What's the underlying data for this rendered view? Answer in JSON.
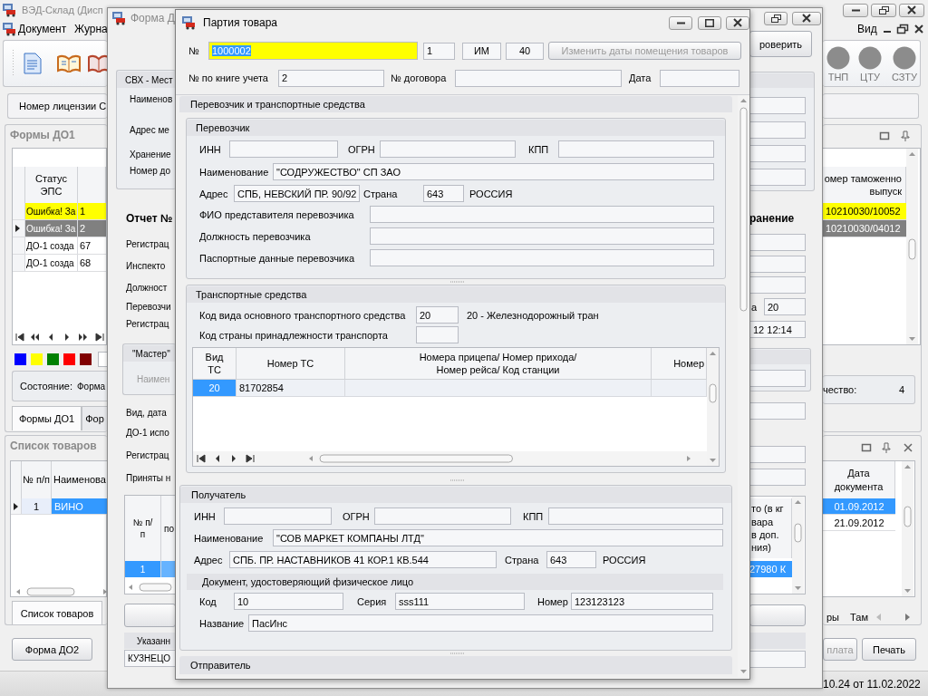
{
  "main_window": {
    "title": "ВЭД-Склад (Дисп",
    "menu": [
      "Документ",
      "Журна"
    ],
    "menu_right": "Вид",
    "indicators": [
      {
        "label": "ТНП"
      },
      {
        "label": "ЦТУ"
      },
      {
        "label": "СЗТУ"
      }
    ],
    "license_label": "Номер лицензии С",
    "do1_panel": {
      "title": "Формы ДО1",
      "column": "Статус ЭПС",
      "right_header": [
        "омер таможенно",
        "выпуск"
      ],
      "rows": [
        {
          "cells": [
            "Ошибка! За",
            "1"
          ],
          "right": "10210030/10052",
          "color": "#ffff00",
          "selected": false
        },
        {
          "cells": [
            "Ошибка! За",
            "2"
          ],
          "right": "10210030/04012",
          "selected": true
        },
        {
          "cells": [
            "ДО-1 созда",
            "67"
          ],
          "selected": false
        },
        {
          "cells": [
            "ДО-1 созда",
            "68"
          ],
          "selected": false
        }
      ]
    },
    "palette": [
      {
        "color": "#0000ff"
      },
      {
        "color": "#ffff00"
      },
      {
        "color": "#008000"
      },
      {
        "color": "#ff0000"
      },
      {
        "color": "#800000"
      }
    ],
    "state_label": "Состояние:",
    "state_value": "Форма",
    "count_label": "чество:",
    "count_value": "4",
    "do1_tabs": [
      {
        "label": "Формы ДО1",
        "selected": true
      },
      {
        "label": "Фор",
        "selected": false
      }
    ],
    "goods_panel": {
      "title": "Список товаров",
      "columns": [
        "№ п/п",
        "Наименова"
      ],
      "rows": [
        {
          "cells": [
            "1",
            "ВИНО"
          ],
          "selected": true
        }
      ],
      "doc_header": "Дата документа",
      "doc_rows": [
        {
          "date": "01.09.2012",
          "selected": true
        },
        {
          "date": "21.09.2012",
          "selected": false
        }
      ]
    },
    "goods_tabs": [
      {
        "label": "Список товаров",
        "selected": true
      },
      {
        "label": "ры",
        "selected": false
      },
      {
        "label": "Там",
        "selected": false
      }
    ],
    "buttons": [
      {
        "label": "Форма ДО2",
        "disabled": false
      },
      {
        "label": "плата",
        "disabled": true
      },
      {
        "label": "Печать",
        "disabled": false
      }
    ],
    "status_text": "10.24 от 11.02.2022"
  },
  "form_window": {
    "title": "Форма Д",
    "check_button": "роверить",
    "svh_group": "СВХ - Мест",
    "svh_labels": [
      "Наименов",
      "Адрес ме",
      "Хранение",
      "Номер до"
    ],
    "report_label": "Отчет №",
    "report_right": "ранение",
    "labels_1": [
      "Регистрац",
      "Инспекто",
      "Должност",
      "Перевозчи",
      "Регистрац"
    ],
    "transport_label": "а",
    "transport_value": "20",
    "reg_datetime": "12 12:14",
    "master_group": "\"Мастер\"",
    "master_label": "Наимен",
    "labels_2": [
      "Вид, дата",
      "ДО-1 испо",
      "Регистрац",
      "Приняты н"
    ],
    "grid": {
      "columns": [
        "№ п/п",
        "по"
      ],
      "right_header": [
        "то (в кг",
        "вара",
        "в доп.",
        "ния)"
      ],
      "rows": [
        {
          "cells": [
            "1"
          ],
          "right": "27980 К",
          "selected": true
        }
      ]
    },
    "specified_label": "Указанн",
    "specified_value": "КУЗНЕЦО"
  },
  "dialog": {
    "title": "Партия товара",
    "number_label": "№",
    "number": "1000002",
    "number_text_selected": true,
    "sub_number": "1",
    "kind": "ИМ",
    "count": "40",
    "change_dates_button": {
      "label": "Изменить даты помещения товаров",
      "disabled": true
    },
    "book_label": "№ по книге учета",
    "book_value": "2",
    "contract_label": "№ договора",
    "date_label": "Дата",
    "carrier_section": "Перевозчик и транспортные средства",
    "carrier": {
      "title": "Перевозчик",
      "inn_label": "ИНН",
      "ogrn_label": "ОГРН",
      "kpp_label": "КПП",
      "name_label": "Наименование",
      "name": "\"СОДРУЖЕСТВО\" СП ЗАО",
      "address_label": "Адрес",
      "address": "СПБ, НЕВСКИЙ ПР. 90/92",
      "country_label": "Страна",
      "country_code": "643",
      "country": "РОССИЯ",
      "rep_label": "ФИО представителя перевозчика",
      "position_label": "Должность перевозчика",
      "passport_label": "Паспортные данные перевозчика"
    },
    "transport": {
      "title": "Транспортные средства",
      "type_label": "Код вида основного транспортного средства",
      "type_code": "20",
      "type_name": "20 - Железнодорожный тран",
      "country_label": "Код страны принадлежности транспорта",
      "columns": [
        "Вид\nТС",
        "Номер ТС",
        "Номера прицепа/ Номер прихода/\nНомер рейса/ Код станции",
        "Номер"
      ],
      "rows": [
        {
          "cells": [
            "20",
            "81702854"
          ],
          "selected": true
        }
      ]
    },
    "recipient": {
      "title": "Получатель",
      "inn_label": "ИНН",
      "ogrn_label": "ОГРН",
      "kpp_label": "КПП",
      "name_label": "Наименование",
      "name": "\"СОВ МАРКЕТ КОМПАНЫ ЛТД\"",
      "address_label": "Адрес",
      "address": "СПБ. ПР. НАСТАВНИКОВ 41 КОР.1 КВ.544",
      "country_label": "Страна",
      "country_code": "643",
      "country": "РОССИЯ",
      "doc_title": "Документ, удостоверяющий физическое лицо",
      "code_label": "Код",
      "code": "10",
      "series_label": "Серия",
      "series": "sss111",
      "number_label": "Номер",
      "number": "123123123",
      "doc_name_label": "Название",
      "doc_name": "ПасИнс"
    },
    "sender": {
      "title": "Отправитель"
    }
  }
}
